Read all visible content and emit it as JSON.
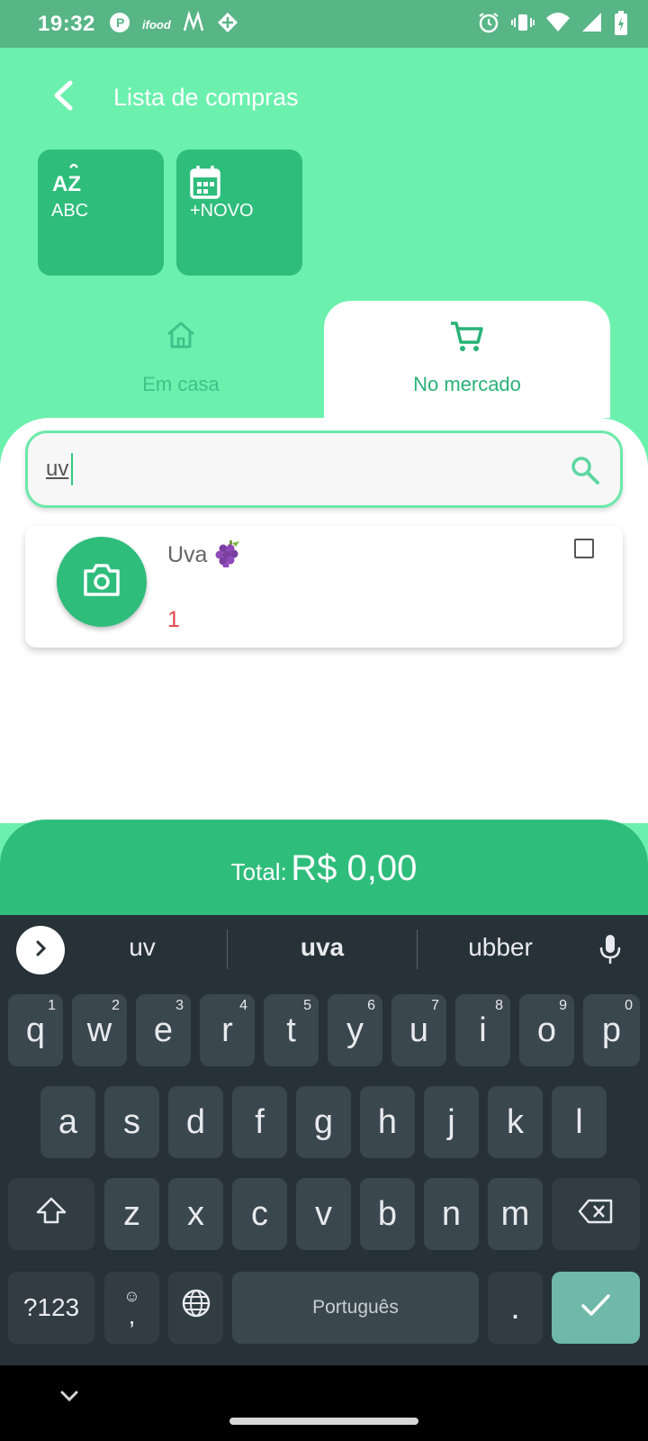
{
  "status_bar": {
    "time": "19:32",
    "left_icons": [
      "picpay-icon",
      "ifood-icon",
      "mercado-icon",
      "diamond-icon"
    ],
    "ifood_text": "ifood",
    "right_icons": [
      "alarm-icon",
      "vibrate-icon",
      "wifi-icon",
      "signal-icon",
      "battery-charging-icon"
    ]
  },
  "header": {
    "title": "Lista de compras",
    "back_icon": "back-arrow-icon"
  },
  "actions": [
    {
      "label": "ABC",
      "icon": "sort-az-icon",
      "icon_text": "AZ"
    },
    {
      "label": "+NOVO",
      "icon": "calendar-icon"
    }
  ],
  "tabs": [
    {
      "label": "Em casa",
      "icon": "home-icon",
      "selected": false
    },
    {
      "label": "No mercado",
      "icon": "cart-icon",
      "selected": true
    }
  ],
  "search": {
    "value": "uv",
    "icon": "search-icon"
  },
  "items": [
    {
      "name": "Uva",
      "emoji": "grape-icon",
      "quantity": "1",
      "checked": false,
      "photo_icon": "camera-icon"
    }
  ],
  "total": {
    "label": "Total:",
    "value": "R$ 0,00"
  },
  "keyboard": {
    "suggestions": [
      "uv",
      "uva",
      "ubber"
    ],
    "row1": [
      {
        "key": "q",
        "hint": "1"
      },
      {
        "key": "w",
        "hint": "2"
      },
      {
        "key": "e",
        "hint": "3"
      },
      {
        "key": "r",
        "hint": "4"
      },
      {
        "key": "t",
        "hint": "5"
      },
      {
        "key": "y",
        "hint": "6"
      },
      {
        "key": "u",
        "hint": "7"
      },
      {
        "key": "i",
        "hint": "8"
      },
      {
        "key": "o",
        "hint": "9"
      },
      {
        "key": "p",
        "hint": "0"
      }
    ],
    "row2": [
      "a",
      "s",
      "d",
      "f",
      "g",
      "h",
      "j",
      "k",
      "l"
    ],
    "row3": [
      "z",
      "x",
      "c",
      "v",
      "b",
      "n",
      "m"
    ],
    "symbols_label": "?123",
    "comma_label": ",",
    "space_label": "Português",
    "period_label": ".",
    "accent_color": "#6fb8aa"
  },
  "colors": {
    "brand_light": "#6cf0ae",
    "brand_dark": "#2fbd7c",
    "status_bar": "#57b586",
    "quantity": "#e0474c"
  }
}
